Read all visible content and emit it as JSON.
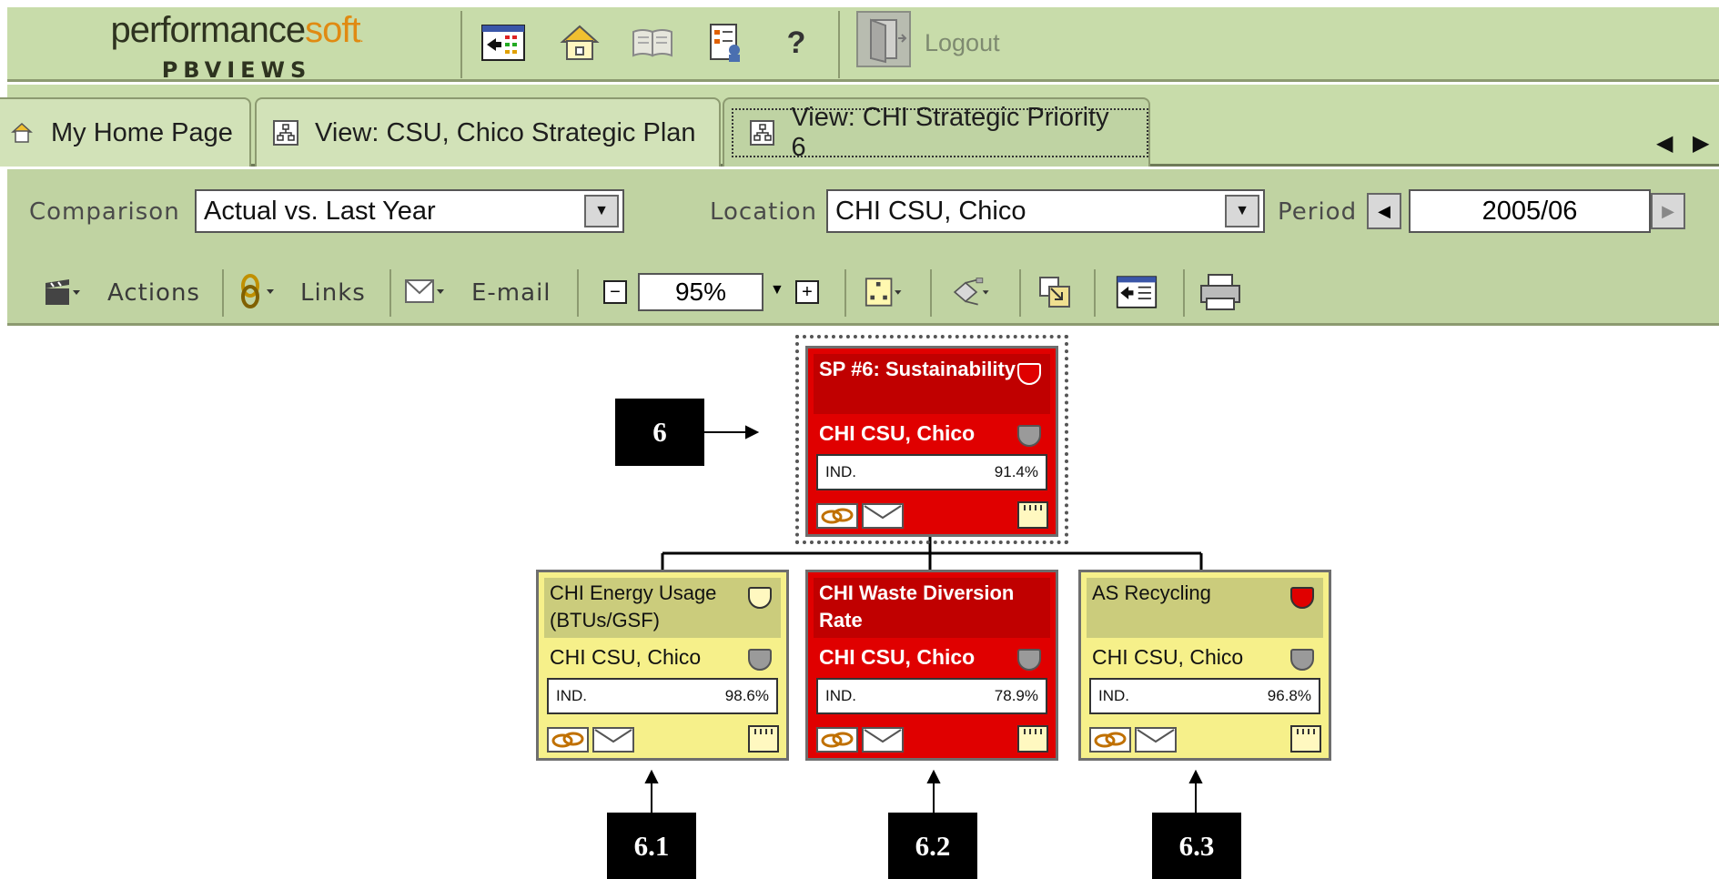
{
  "header": {
    "logo_main_left": "performance",
    "logo_main_right": "soft",
    "logo_sub": "PBVIEWS",
    "logout_label": "Logout",
    "help_label": "?",
    "icons": [
      "scorecard-view-icon",
      "home-icon",
      "book-icon",
      "report-icon",
      "help-icon",
      "logout-door-icon"
    ]
  },
  "tabs": [
    {
      "label": "My Home Page",
      "icon": "home-icon"
    },
    {
      "label": "View: CSU, Chico Strategic Plan",
      "icon": "hierarchy-icon"
    },
    {
      "label": "View: CHI Strategic Priority 6",
      "icon": "hierarchy-icon",
      "active": true
    }
  ],
  "tab_scroll": {
    "left": "◀",
    "right": "▶"
  },
  "filters": {
    "comparison_label": "Comparison",
    "comparison_value": "Actual vs. Last Year",
    "location_label": "Location",
    "location_value": "CHI CSU, Chico",
    "period_label": "Period",
    "period_value": "2005/06"
  },
  "toolbar": {
    "actions_label": "Actions",
    "links_label": "Links",
    "email_label": "E-mail",
    "zoom_value": "95%",
    "zoom_minus": "−",
    "zoom_plus": "+"
  },
  "map": {
    "root": {
      "title": "SP #6: Sustainability",
      "location": "CHI CSU, Chico",
      "indicator": "IND.",
      "value": "91.4%",
      "status_color": "#e00000"
    },
    "children": [
      {
        "title": "CHI Energy Usage (BTUs/GSF)",
        "location": "CHI CSU, Chico",
        "indicator": "IND.",
        "value": "98.6%",
        "status_color": "#f6f08a"
      },
      {
        "title": "CHI Waste Diversion Rate",
        "location": "CHI CSU, Chico",
        "indicator": "IND.",
        "value": "78.9%",
        "status_color": "#e00000"
      },
      {
        "title": "AS Recycling",
        "location": "CHI CSU, Chico",
        "indicator": "IND.",
        "value": "96.8%",
        "status_color": "#f6f08a"
      }
    ]
  },
  "callouts": {
    "root": "6",
    "c1": "6.1",
    "c2": "6.2",
    "c3": "6.3"
  }
}
